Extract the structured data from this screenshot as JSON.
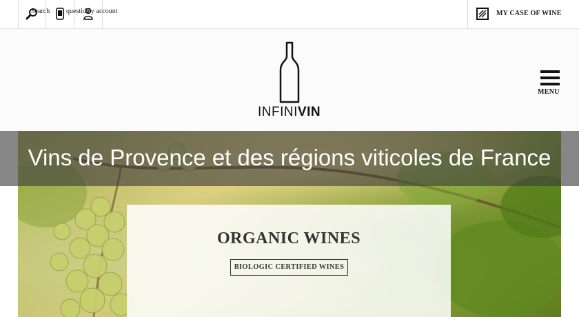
{
  "topbar": {
    "search_label": "Search",
    "question_label": "question",
    "account_label": "My account",
    "case_label": "MY CASE OF WINE"
  },
  "header": {
    "logo_thin": "INFINI",
    "logo_bold": "VIN",
    "menu_label": "MENU"
  },
  "banner": {
    "text": "Vins de Provence et des régions viticoles de France"
  },
  "promo": {
    "title": "ORGANIC WINES",
    "button_label": "BIOLOGIC CERTIFIED WINES"
  },
  "icons": [
    "search-icon",
    "phone-icon",
    "user-icon",
    "wine-case-icon",
    "wine-bottle-logo-icon",
    "hamburger-menu-icon"
  ],
  "colors": {
    "banner_overlay": "#3c3c3c",
    "text_dark": "#333333"
  }
}
